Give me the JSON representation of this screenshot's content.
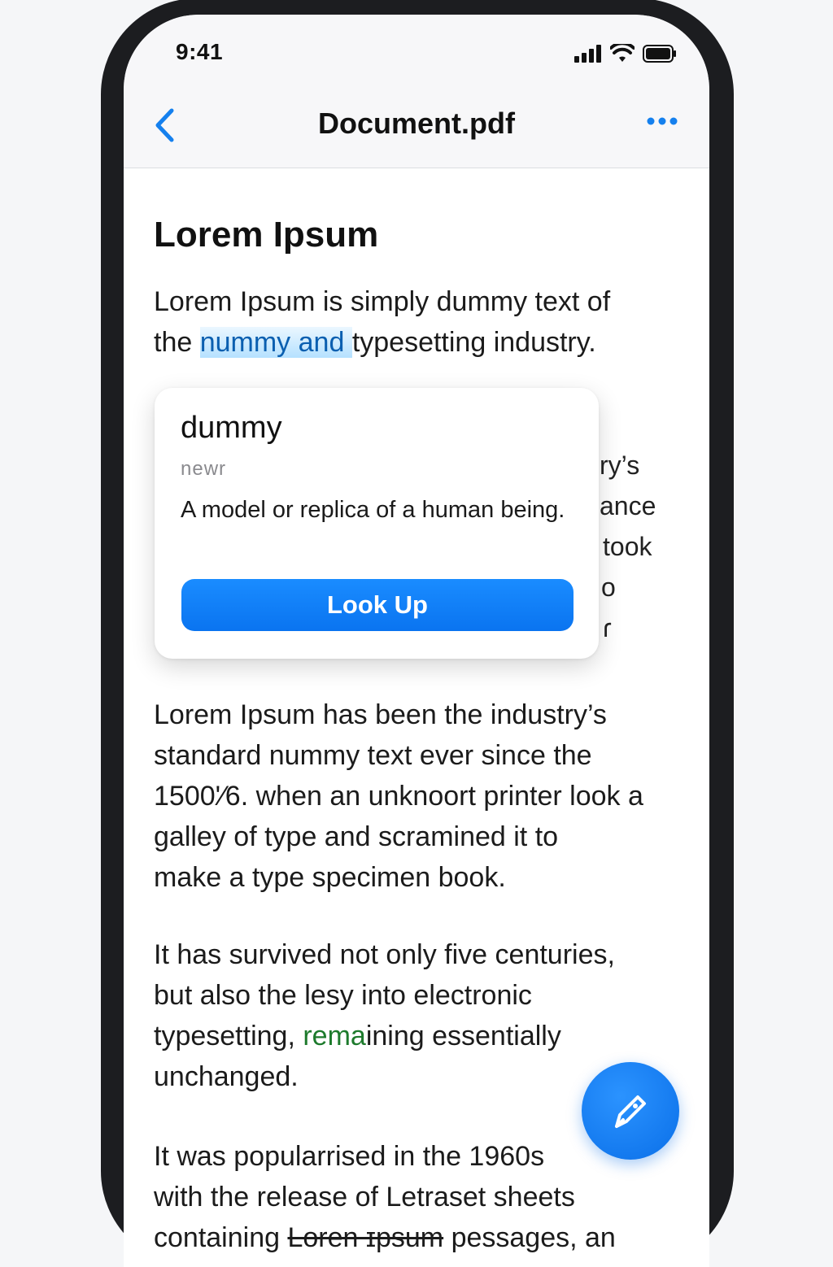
{
  "status_bar": {
    "time": "9:41"
  },
  "nav": {
    "title": "Document.pdf"
  },
  "document": {
    "heading": "Lorem Ipsum",
    "p1": {
      "line1": "Lorem Ipsum is simply dummy text of",
      "line2_pre": "the ",
      "line2_highlight": "nummy and ",
      "line2_post": "typesetting industry."
    },
    "peek_fragments": [
      "ry’s",
      "ance",
      "took",
      "o",
      "ɾ"
    ],
    "p2": [
      "Lorem Ipsum has been the industry’s",
      "standard nummy text ever since the",
      "1500'⁄6. when an unknoort printer look a",
      "galley of type and scramined it to",
      "make a type specimen book."
    ],
    "p3": {
      "line1": "It has survived not only five centuries,",
      "line2": "but also the lesy into electronic",
      "line3_pre": "typesetting, ",
      "line3_green": "rema",
      "line3_post": "ining essentially",
      "line4": "unchanged."
    },
    "p4": {
      "line1": "It was popularrised in the 1960s",
      "line2": "with the release of Letraset sheets",
      "line3_pre": "containing ",
      "line3_strike": "Loren ɪpsum",
      "line3_post": " pessages, an"
    }
  },
  "popover": {
    "word": "dummy",
    "part_of_speech": "newr",
    "definition": "A model or replica of a human being.",
    "button_label": "Look Up"
  },
  "colors": {
    "accent": "#0a7cff",
    "highlight_text": "#0a5fb0",
    "green_text": "#1d7a2c"
  },
  "icons": [
    "signal-icon",
    "wifi-icon",
    "battery-icon",
    "back-chevron-icon",
    "more-icon",
    "pen-icon"
  ]
}
